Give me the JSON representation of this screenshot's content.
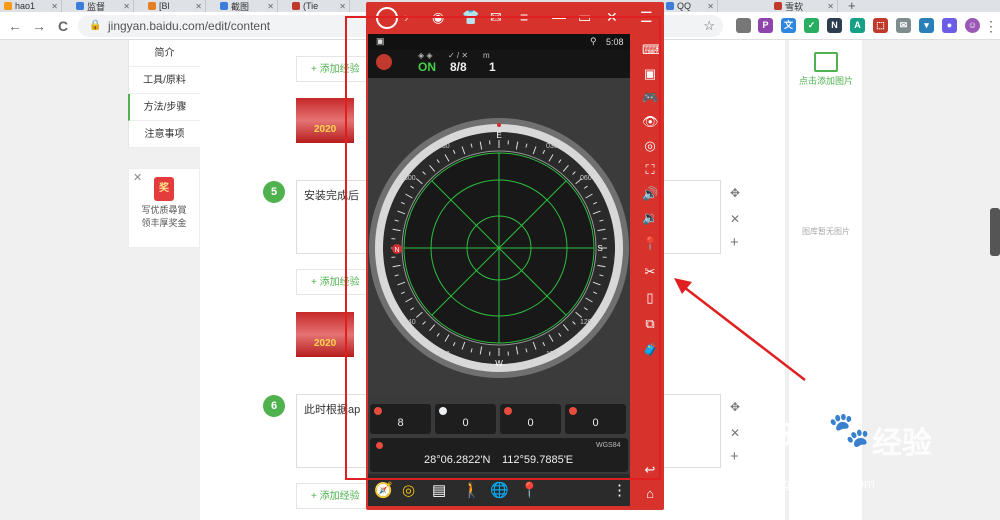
{
  "browser": {
    "tabs": [
      {
        "label": "hao1",
        "color": "#f39c12"
      },
      {
        "label": "监督",
        "color": "#3b7dd8"
      },
      {
        "label": "[Bl",
        "color": "#e67e22"
      },
      {
        "label": "截图",
        "color": "#3b7dd8"
      },
      {
        "label": "(Tie",
        "color": "#c0392b"
      },
      {
        "label": "",
        "color": "#999999"
      },
      {
        "label": "QQ",
        "color": "#3b7dd8"
      },
      {
        "label": "雪软",
        "color": "#c0392b"
      }
    ],
    "new_tab": "+",
    "url": "jingyan.baidu.com/edit/content",
    "back": "←",
    "forward": "→",
    "reload": "C",
    "extensions": [
      {
        "label": "",
        "color": "#777777"
      },
      {
        "label": "P",
        "color": "#8e44ad"
      },
      {
        "label": "文",
        "color": "#2e86de"
      },
      {
        "label": "✓",
        "color": "#27ae60"
      },
      {
        "label": "N",
        "color": "#2c3e50"
      },
      {
        "label": "A",
        "color": "#16a085"
      },
      {
        "label": "⬚",
        "color": "#c0392b"
      },
      {
        "label": "✉",
        "color": "#7f8c8d"
      },
      {
        "label": "▾",
        "color": "#2980b9"
      },
      {
        "label": "●",
        "color": "#6c5ce7"
      },
      {
        "label": "☺",
        "color": "#9b59b6"
      }
    ]
  },
  "leftnav": {
    "items": [
      {
        "label": "简介"
      },
      {
        "label": "工具/原料"
      },
      {
        "label": "方法/步骤"
      },
      {
        "label": "注意事项"
      }
    ],
    "active_index": 2
  },
  "reward": {
    "close": "✕",
    "badge": "奖",
    "line1": "写优质尋賞",
    "line2": "领丰厚奖金"
  },
  "editor": {
    "add_label": "+ 添加经验",
    "thumb_year": "2020",
    "steps": [
      {
        "num": "5",
        "text": "安装完成后"
      },
      {
        "num": "6",
        "text": "此时根据ap"
      }
    ],
    "move_icon": "✥",
    "delete_icon": "✕",
    "add_icon": "+"
  },
  "rightpanel": {
    "add_image": "点击添加图片",
    "no_image": "图库暂无图片"
  },
  "emulator": {
    "side_icons": [
      "⌨",
      "▣",
      "🎮",
      "👁",
      "◎",
      "⛶",
      "🔊",
      "🔉",
      "📍",
      "✂",
      "▯",
      "⧉",
      "🧳",
      "↩",
      "⌂"
    ],
    "status": {
      "time": "5:08",
      "pin": "⚲"
    },
    "gps": {
      "state": "ON",
      "sats": "8/8",
      "extra": "1",
      "label1": "◈ ◈",
      "label2": "✓ / ✕",
      "label3": "m"
    },
    "compass": {
      "letters": [
        "E",
        "S",
        "W",
        "N"
      ],
      "degrees": [
        "030",
        "060",
        "120",
        "150",
        "210",
        "240",
        "300",
        "330"
      ]
    },
    "sat_counts": [
      {
        "value": "8",
        "color": "#e74c3c"
      },
      {
        "value": "0",
        "color": "#ecf0f1"
      },
      {
        "value": "0",
        "color": "#e74c3c"
      },
      {
        "value": "0",
        "color": "#e74c3c"
      }
    ],
    "coords": {
      "lat": "28°06.2822'N",
      "lon": "112°59.7885'E",
      "datum": "WGS84"
    }
  },
  "watermark": {
    "brand": "Bai",
    "brand2": "经验",
    "url": "jingyan.baidu.com"
  },
  "colors": {
    "accent_green": "#4fb24f",
    "emulator_red": "#d8322c",
    "highlight_red": "#e02020"
  }
}
